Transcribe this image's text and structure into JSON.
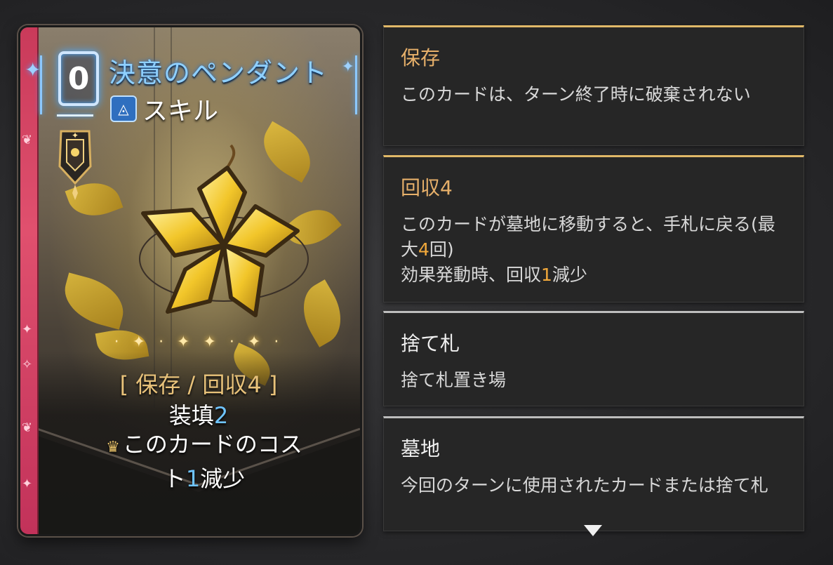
{
  "card": {
    "cost": "0",
    "name": "決意のペンダント",
    "type_label": "スキル",
    "keywords_open": "[ ",
    "keywords_text": "保存 / 回収4",
    "keywords_close": " ]",
    "effect1_prefix": "装填",
    "effect1_num": "2",
    "effect2_line1": "このカードのコス",
    "effect2_line2_prefix": "ト",
    "effect2_num": "1",
    "effect2_suffix": "減少",
    "icons": [
      "cost-frame",
      "skill-type-icon",
      "rarity-badge",
      "crown-icon",
      "star-pendant-art"
    ],
    "colors": {
      "ribbon": "#e0506e",
      "cost_glow": "#4aa8ff",
      "title": "#8fd0ff",
      "keyword": "#e8c27a",
      "number_blue": "#6fc4ff"
    }
  },
  "tooltips": [
    {
      "title": "保存",
      "body": "このカードは、ターン終了時に破棄されない",
      "style": "gold"
    },
    {
      "title": "回収4",
      "body_line1_a": "このカードが墓地に移動すると、手札に戻る(最大",
      "body_line1_num": "4",
      "body_line1_b": "回)",
      "body_line2_a": "効果発動時、回収",
      "body_line2_num": "1",
      "body_line2_b": "減少",
      "style": "gold"
    },
    {
      "title": "捨て札",
      "body": "捨て札置き場",
      "style": "silver"
    },
    {
      "title": "墓地",
      "body": "今回のターンに使用されたカードまたは捨て札",
      "style": "silver"
    }
  ],
  "scroll": {
    "more_indicator": "chevron-down-icon"
  }
}
